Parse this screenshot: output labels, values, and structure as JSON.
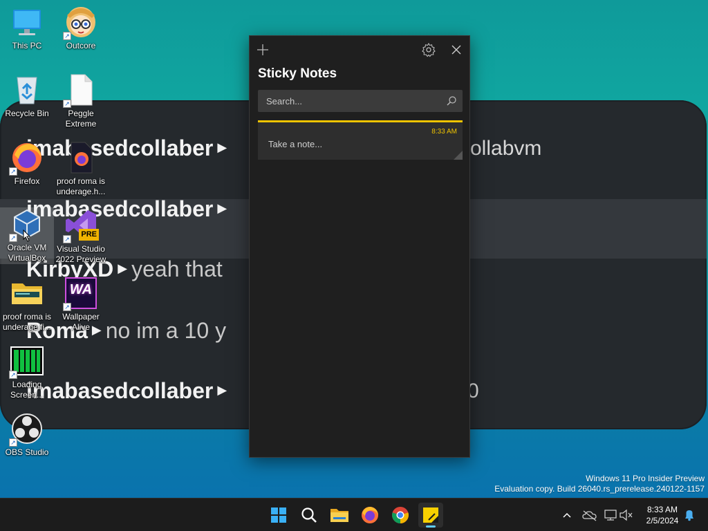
{
  "wallpaper": {
    "rows": [
      {
        "user": "imabasedcollaber",
        "msg": "",
        "right": "ollabvm"
      },
      {
        "user": "imabasedcollaber",
        "msg": "",
        "right": ""
      },
      {
        "user": "KirbyXD",
        "msg": "yeah that",
        "right": ""
      },
      {
        "user": "Roma",
        "msg": "no im a 10 y",
        "right": ""
      },
      {
        "user": "imabasedcollaber",
        "msg": "",
        "right": "0"
      }
    ]
  },
  "desktop": {
    "icons": [
      {
        "label": "This PC"
      },
      {
        "label": "Outcore"
      },
      {
        "label": "Recycle Bin"
      },
      {
        "label": "Peggle Extreme"
      },
      {
        "label": "Firefox"
      },
      {
        "label": "proof roma is underage.h..."
      },
      {
        "label": "Oracle VM VirtualBox"
      },
      {
        "label": "Visual Studio 2022 Preview"
      },
      {
        "label": "proof roma is underage.fi..."
      },
      {
        "label": "Wallpaper Alive"
      },
      {
        "label": "Loading Screen..."
      },
      {
        "label": "OBS Studio"
      }
    ],
    "vs_badge": "PRE",
    "wa_badge": "WA"
  },
  "sticky_notes": {
    "title": "Sticky Notes",
    "search_placeholder": "Search...",
    "note": {
      "time": "8:33 AM",
      "text": "Take a note...",
      "accent": "#eec300"
    }
  },
  "watermark": {
    "line1": "Windows 11 Pro Insider Preview",
    "line2": "Evaluation copy. Build 26040.rs_prerelease.240122-1157"
  },
  "taskbar": {
    "apps": [
      "start-icon",
      "search-icon",
      "file-explorer-icon",
      "firefox-icon",
      "chrome-icon",
      "sticky-notes-icon"
    ],
    "clock": {
      "time": "8:33 AM",
      "date": "2/5/2024"
    }
  },
  "colors": {
    "accent": "#60cdff",
    "note_yellow": "#eec300"
  }
}
